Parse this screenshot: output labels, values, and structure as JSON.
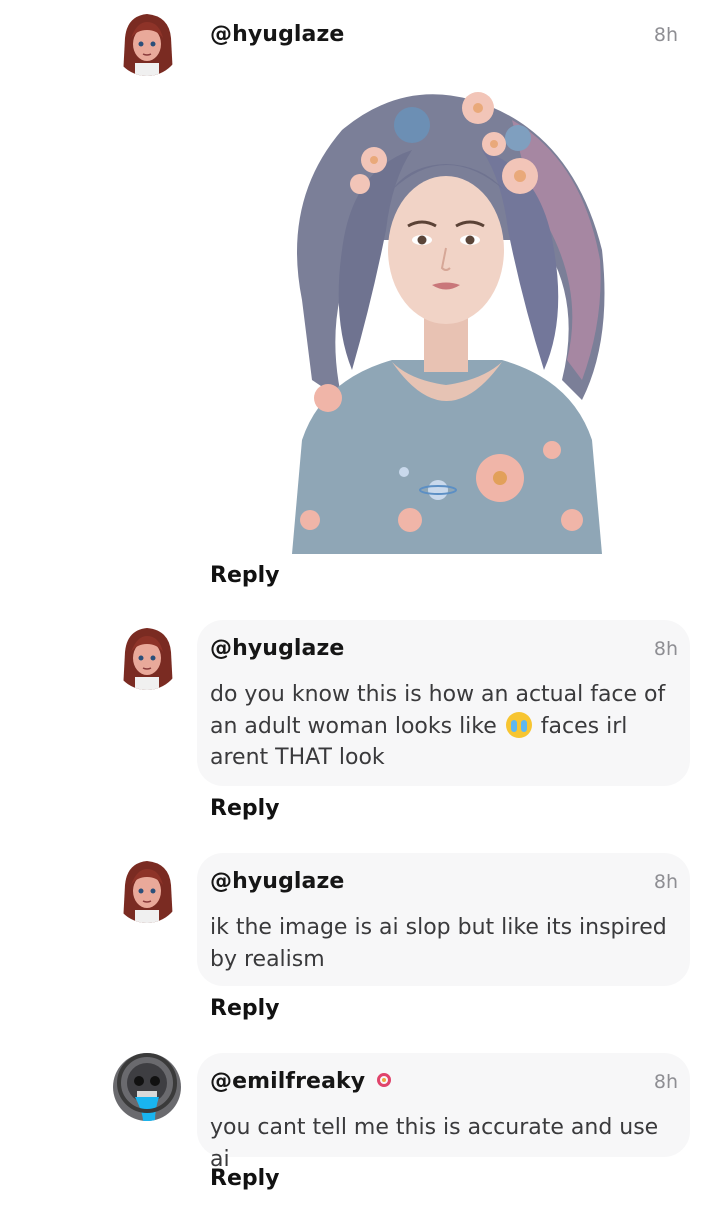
{
  "comments": [
    {
      "username": "@hyuglaze",
      "time": "8h",
      "text": "",
      "has_image": true,
      "reply_label": "Reply"
    },
    {
      "username": "@hyuglaze",
      "time": "8h",
      "text_before_emoji": "do you know this is how an actual face of an adult woman looks like ",
      "emoji": "😭",
      "text_after_emoji": " faces irl arent THAT look",
      "reply_label": "Reply"
    },
    {
      "username": "@hyuglaze",
      "time": "8h",
      "text": "ik the image is ai slop but like its inspired by realism",
      "reply_label": "Reply"
    },
    {
      "username": "@emilfreaky",
      "time": "8h",
      "text": "you cant tell me this is accurate and use ai",
      "reply_label": "Reply"
    }
  ],
  "colors": {
    "bubble": "#f7f7f8",
    "username": "#161616",
    "time": "#8e8e93",
    "badge": "#e0446b"
  }
}
